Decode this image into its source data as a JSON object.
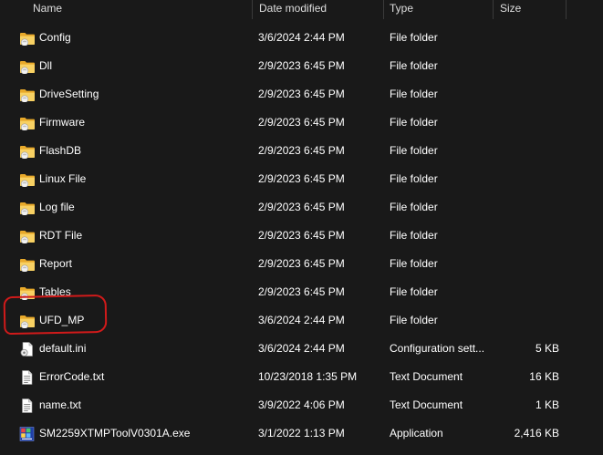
{
  "columns": {
    "name": "Name",
    "date": "Date modified",
    "type": "Type",
    "size": "Size"
  },
  "files": [
    {
      "name": "Config",
      "date": "3/6/2024 2:44 PM",
      "type": "File folder",
      "size": "",
      "icon": "folder-icon"
    },
    {
      "name": "Dll",
      "date": "2/9/2023 6:45 PM",
      "type": "File folder",
      "size": "",
      "icon": "folder-icon"
    },
    {
      "name": "DriveSetting",
      "date": "2/9/2023 6:45 PM",
      "type": "File folder",
      "size": "",
      "icon": "folder-icon"
    },
    {
      "name": "Firmware",
      "date": "2/9/2023 6:45 PM",
      "type": "File folder",
      "size": "",
      "icon": "folder-icon"
    },
    {
      "name": "FlashDB",
      "date": "2/9/2023 6:45 PM",
      "type": "File folder",
      "size": "",
      "icon": "folder-icon"
    },
    {
      "name": "Linux File",
      "date": "2/9/2023 6:45 PM",
      "type": "File folder",
      "size": "",
      "icon": "folder-icon"
    },
    {
      "name": "Log file",
      "date": "2/9/2023 6:45 PM",
      "type": "File folder",
      "size": "",
      "icon": "folder-icon"
    },
    {
      "name": "RDT File",
      "date": "2/9/2023 6:45 PM",
      "type": "File folder",
      "size": "",
      "icon": "folder-icon"
    },
    {
      "name": "Report",
      "date": "2/9/2023 6:45 PM",
      "type": "File folder",
      "size": "",
      "icon": "folder-icon"
    },
    {
      "name": "Tables",
      "date": "2/9/2023 6:45 PM",
      "type": "File folder",
      "size": "",
      "icon": "folder-icon"
    },
    {
      "name": "UFD_MP",
      "date": "3/6/2024 2:44 PM",
      "type": "File folder",
      "size": "",
      "icon": "folder-icon"
    },
    {
      "name": "default.ini",
      "date": "3/6/2024 2:44 PM",
      "type": "Configuration sett...",
      "size": "5 KB",
      "icon": "ini-file-icon"
    },
    {
      "name": "ErrorCode.txt",
      "date": "10/23/2018 1:35 PM",
      "type": "Text Document",
      "size": "16 KB",
      "icon": "text-file-icon"
    },
    {
      "name": "name.txt",
      "date": "3/9/2022 4:06 PM",
      "type": "Text Document",
      "size": "1 KB",
      "icon": "text-file-icon"
    },
    {
      "name": "SM2259XTMPToolV0301A.exe",
      "date": "3/1/2022 1:13 PM",
      "type": "Application",
      "size": "2,416 KB",
      "icon": "application-icon"
    }
  ],
  "highlight_color": "#d11a1a",
  "folder_color": "#f4c64e"
}
